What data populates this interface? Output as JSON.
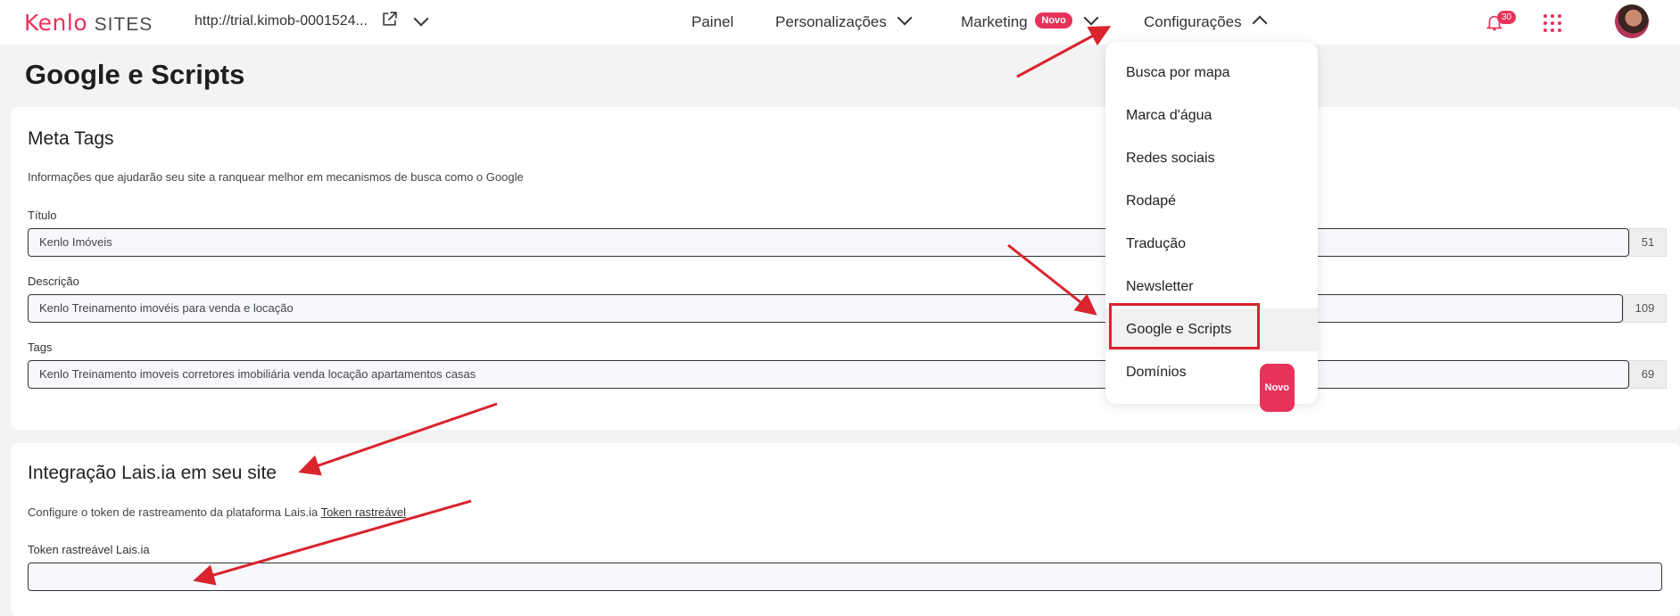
{
  "brand": {
    "logo_main": "Kenlo",
    "logo_sub": "SITES"
  },
  "header": {
    "url": "http://trial.kimob-0001524...",
    "nav": [
      "Painel",
      "Personalizações",
      "Marketing",
      "Configurações"
    ],
    "badge_novo": "Novo",
    "notification_count": "30"
  },
  "page": {
    "title": "Google e Scripts"
  },
  "meta_tags": {
    "title": "Meta Tags",
    "description": "Informações que ajudarão seu site a ranquear melhor em mecanismos de busca como o Google",
    "fields": [
      {
        "label": "Título",
        "value": "Kenlo Imóveis",
        "count": "51"
      },
      {
        "label": "Descrição",
        "value": "Kenlo Treinamento imovéis para venda e locação",
        "count": "109"
      },
      {
        "label": "Tags",
        "value": "Kenlo Treinamento imoveis corretores imobiliária venda locação apartamentos casas",
        "count": "69"
      }
    ]
  },
  "lais": {
    "title": "Integração Lais.ia em seu site",
    "description": "Configure o token de rastreamento da plataforma Lais.ia",
    "link": "Token rastreável",
    "field_label": "Token rastreável Lais.ia",
    "field_value": ""
  },
  "menu": {
    "items": [
      "Busca por mapa",
      "Marca d'água",
      "Redes sociais",
      "Rodapé",
      "Tradução",
      "Newsletter",
      "Google e Scripts",
      "Domínios"
    ],
    "active": "Google e Scripts",
    "badge": "Novo"
  },
  "colors": {
    "accent": "#e8325a",
    "annotation": "#d9232d"
  }
}
